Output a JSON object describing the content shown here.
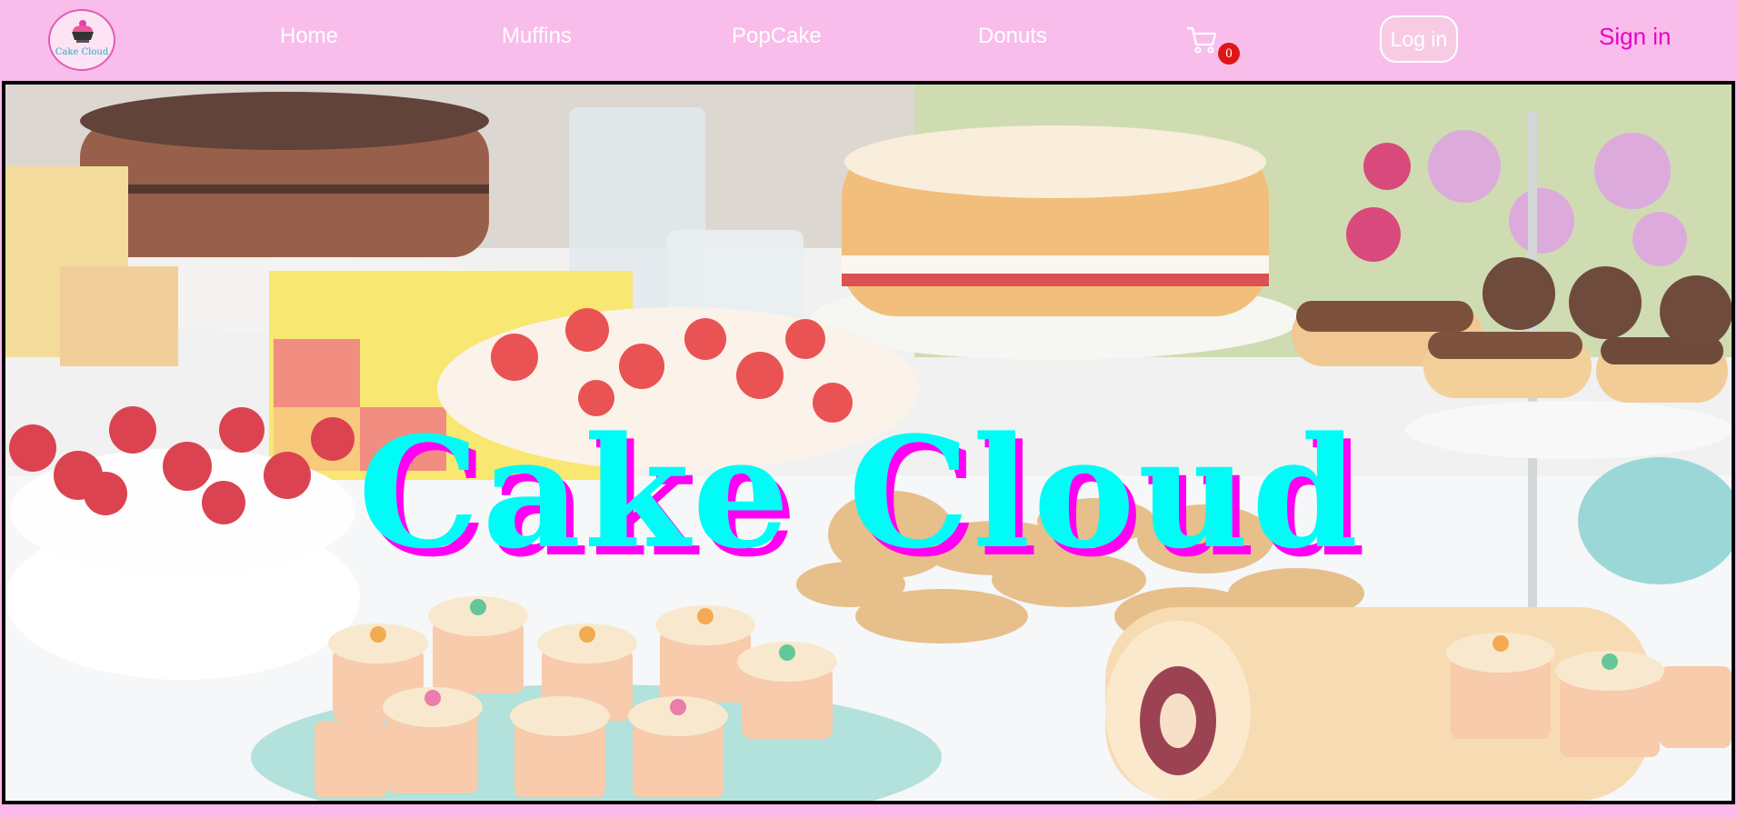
{
  "nav": {
    "logo_text": "Cake Cloud",
    "links": [
      {
        "label": "Home"
      },
      {
        "label": "Muffins"
      },
      {
        "label": "PopCake"
      },
      {
        "label": "Donuts"
      }
    ],
    "cart": {
      "icon": "cart-icon",
      "count": "0"
    },
    "login_label": "Log in",
    "signin_label": "Sign in"
  },
  "hero": {
    "title": "Cake Cloud",
    "background": "photo of cakes, cupcakes, cookies and desserts on a table"
  },
  "colors": {
    "nav_bg": "#f9bdeb",
    "title_fill": "#00fcf6",
    "title_shadow": "#ff00f2",
    "signin": "#e800c4",
    "badge": "#e01515"
  }
}
